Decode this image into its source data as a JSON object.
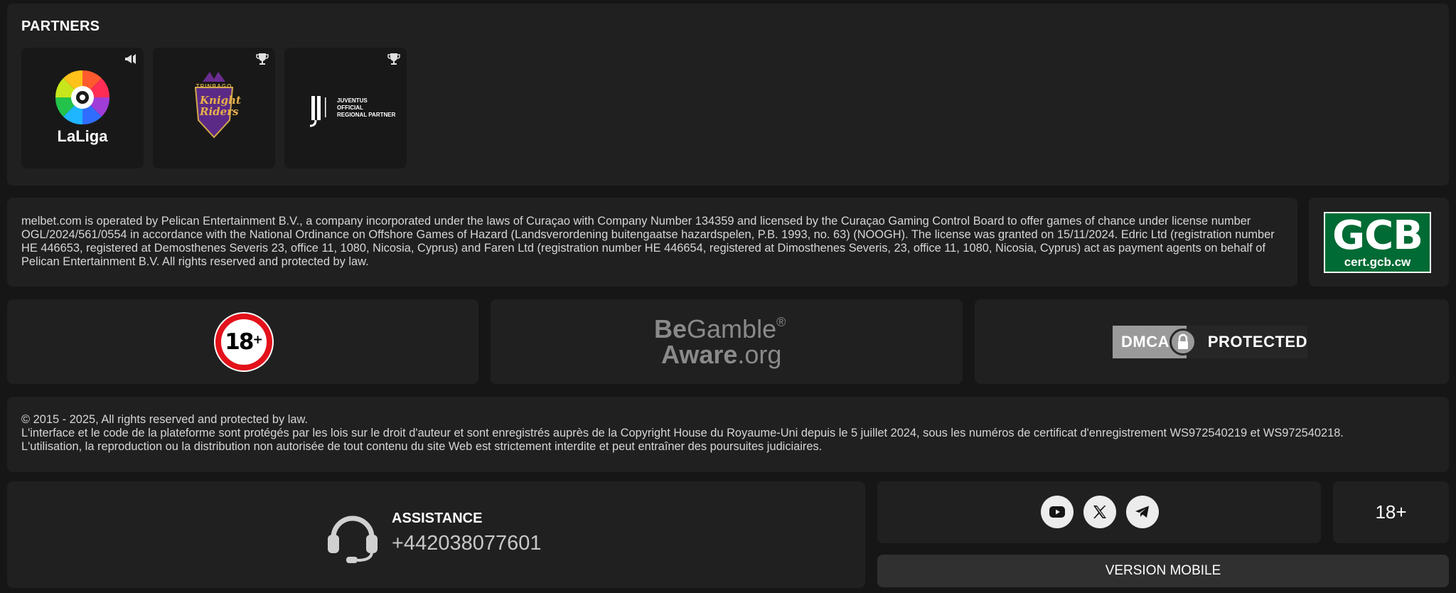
{
  "partners": {
    "title": "PARTNERS",
    "items": [
      {
        "name": "LaLiga",
        "label": "LaLiga",
        "badge": "megaphone-icon"
      },
      {
        "name": "Knight Riders",
        "label": "Knight Riders",
        "sub": "TRINBAGO",
        "badge": "trophy-icon"
      },
      {
        "name": "Juventus",
        "lines": [
          "JUVENTUS",
          "OFFICIAL",
          "REGIONAL PARTNER"
        ],
        "badge": "trophy-icon"
      }
    ]
  },
  "license": {
    "text": "melbet.com is operated by Pelican Entertainment B.V., a company incorporated under the laws of Curaçao with Company Number 134359 and licensed by the Curaçao Gaming Control Board to offer games of chance under license number OGL/2024/561/0554 in accordance with the National Ordinance on Offshore Games of Hazard (Landsverordening buitengaatse hazardspelen, P.B. 1993, no. 63) (NOOGH). The license was granted on 15/11/2024. Edric Ltd (registration number HE 446653, registered at Demosthenes Severis 23, office 11, 1080, Nicosia, Cyprus) and Faren Ltd (registration number HE 446654, registered at Dimosthenes Severis, 23, office 11, 1080, Nicosia, Cyprus) act as payment agents on behalf of Pelican Entertainment B.V. All rights reserved and protected by law.",
    "gcb_main": "GCB",
    "gcb_sub": "cert.gcb.cw"
  },
  "badges": {
    "age_number": "18",
    "age_plus": "+",
    "begamble_be": "Be",
    "begamble_gamble": "Gamble",
    "begamble_reg": "®",
    "begamble_aware": "Aware",
    "begamble_org": ".org",
    "dmca_left": "DMCA",
    "dmca_right": "PROTECTED"
  },
  "copyright": {
    "line1": "© 2015 - 2025, All rights reserved and protected by law.",
    "line2": "L'interface et le code de la plateforme sont protégés par les lois sur le droit d'auteur et sont enregistrés auprès de la Copyright House du Royaume-Uni depuis le 5 juillet 2024, sous les numéros de certificat d'enregistrement WS972540219 et WS972540218.",
    "line3": "L'utilisation, la reproduction ou la distribution non autorisée de tout contenu du site Web est strictement interdite et peut entraîner des poursuites judiciaires."
  },
  "assistance": {
    "title": "ASSISTANCE",
    "phone": "+442038077601",
    "icon": "headset-icon"
  },
  "social": [
    {
      "name": "youtube",
      "icon": "youtube-icon"
    },
    {
      "name": "x",
      "icon": "x-icon"
    },
    {
      "name": "telegram",
      "icon": "telegram-icon"
    }
  ],
  "age_small": "18+",
  "mobile_button": "VERSION MOBILE",
  "colors": {
    "background": "#161616",
    "panel": "#202020",
    "gcb_green": "#006b34",
    "age_red": "#e3111a"
  }
}
